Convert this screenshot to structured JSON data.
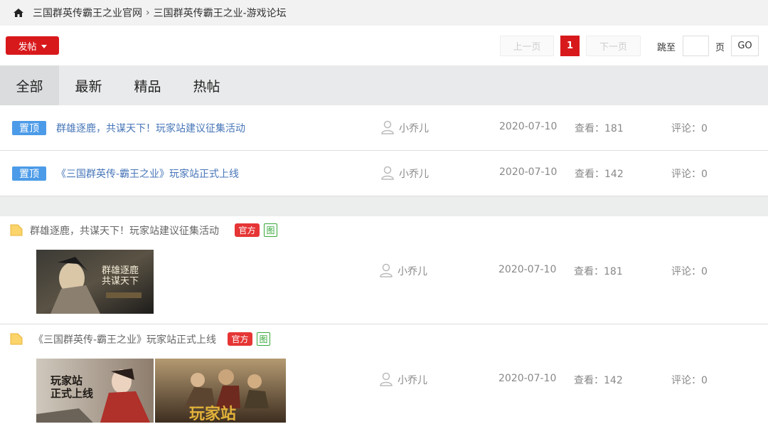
{
  "breadcrumb": {
    "home": "三国群英传霸王之业官网",
    "separator": "›",
    "current": "三国群英传霸王之业-游戏论坛"
  },
  "toolbar": {
    "post_label": "发帖",
    "prev_label": "上一页",
    "current_page": "1",
    "next_label": "下一页",
    "jump_label": "跳至",
    "jump_value": "",
    "page_suffix": "页",
    "go_label": "GO"
  },
  "tabs": [
    {
      "label": "全部",
      "active": true
    },
    {
      "label": "最新",
      "active": false
    },
    {
      "label": "精品",
      "active": false
    },
    {
      "label": "热帖",
      "active": false
    }
  ],
  "pinned": [
    {
      "badge": "置顶",
      "title": "群雄逐鹿，共谋天下！玩家站建议征集活动",
      "author": "小乔儿",
      "date": "2020-07-10",
      "views": "查看：181",
      "comments": "评论：0"
    },
    {
      "badge": "置顶",
      "title": "《三国群英传-霸王之业》玩家站正式上线",
      "author": "小乔儿",
      "date": "2020-07-10",
      "views": "查看：142",
      "comments": "评论：0"
    }
  ],
  "posts": [
    {
      "title": "群雄逐鹿，共谋天下！玩家站建议征集活动",
      "badge_official": "官方",
      "badge_image": "图",
      "author": "小乔儿",
      "date": "2020-07-10",
      "views": "查看：181",
      "comments": "评论：0",
      "thumbs": [
        {
          "caption": "群雄逐鹿 共谋天下"
        }
      ]
    },
    {
      "title": "《三国群英传-霸王之业》玩家站正式上线",
      "badge_official": "官方",
      "badge_image": "图",
      "author": "小乔儿",
      "date": "2020-07-10",
      "views": "查看：142",
      "comments": "评论：0",
      "thumbs": [
        {
          "caption": "玩家站 正式上线"
        },
        {
          "caption": "玩家站"
        }
      ]
    }
  ],
  "colors": {
    "accent": "#d8191c",
    "pin_badge": "#4c9be8",
    "link": "#4776b8",
    "official": "#e63535",
    "image_badge": "#37a83a"
  }
}
